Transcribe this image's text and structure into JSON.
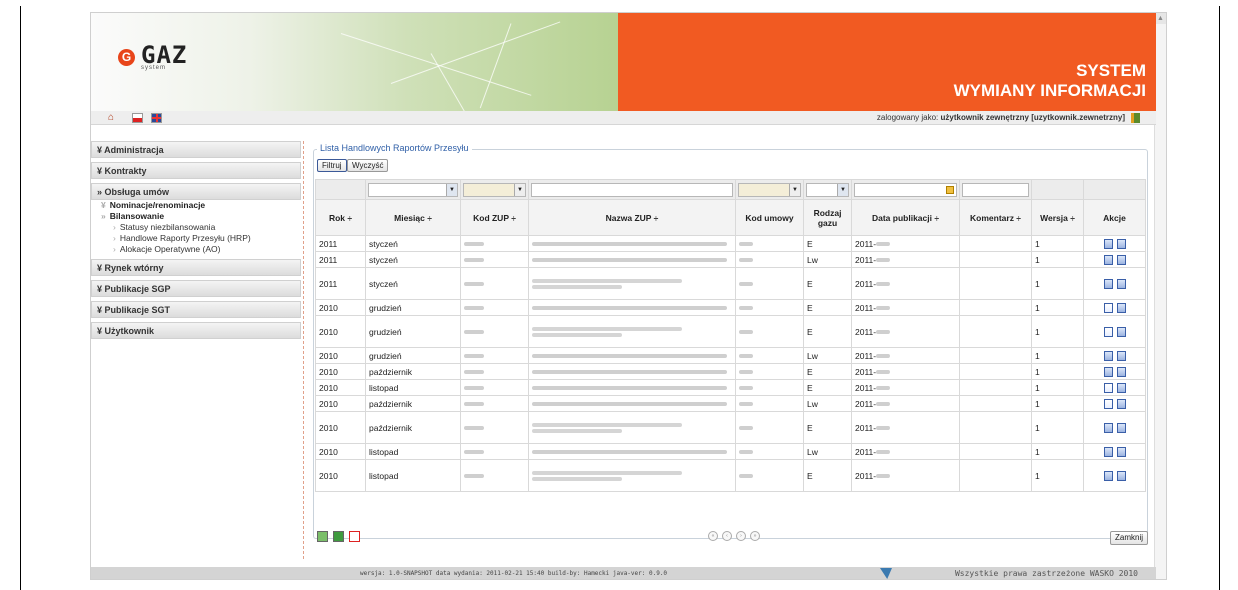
{
  "header": {
    "logo_text": "GAZ",
    "logo_sub": "system",
    "title_line1": "SYSTEM",
    "title_line2": "WYMIANY INFORMACJI"
  },
  "topbar": {
    "login_prefix": "zalogowany jako:",
    "login_user": "użytkownik zewnętrzny [uzytkownik.zewnetrzny]"
  },
  "sidebar": {
    "administracja": "Administracja",
    "kontrakty": "Kontrakty",
    "obsluga": "Obsługa umów",
    "nominacje": "Nominacje/renominacje",
    "bilansowanie": "Bilansowanie",
    "statusy": "Statusy niezbilansowania",
    "hrp": "Handlowe Raporty Przesyłu (HRP)",
    "ao": "Alokacje Operatywne (AO)",
    "rynek": "Rynek wtórny",
    "sgp": "Publikacje SGP",
    "sgt": "Publikacje SGT",
    "uzytkownik": "Użytkownik"
  },
  "panel": {
    "legend": "Lista Handlowych Raportów Przesyłu",
    "filter_btn": "Filtruj",
    "clear_btn": "Wyczyść",
    "close_btn": "Zamknij"
  },
  "table": {
    "headers": {
      "rok": "Rok ÷",
      "miesiac": "Miesiąc ÷",
      "kod_zup": "Kod ZUP ÷",
      "nazwa_zup": "Nazwa ZUP ÷",
      "kod_umowy": "Kod umowy",
      "rodzaj_gazu": "Rodzaj gazu",
      "data_pub": "Data publikacji ÷",
      "komentarz": "Komentarz ÷",
      "wersja": "Wersja ÷",
      "akcje": "Akcje"
    },
    "rows": [
      {
        "rok": "2011",
        "miesiac": "styczeń",
        "gaz": "E",
        "data": "2011-",
        "wersja": "1"
      },
      {
        "rok": "2011",
        "miesiac": "styczeń",
        "gaz": "Lw",
        "data": "2011-",
        "wersja": "1"
      },
      {
        "rok": "2011",
        "miesiac": "styczeń",
        "gaz": "E",
        "data": "2011-",
        "wersja": "1"
      },
      {
        "rok": "2010",
        "miesiac": "grudzień",
        "gaz": "E",
        "data": "2011-",
        "wersja": "1"
      },
      {
        "rok": "2010",
        "miesiac": "grudzień",
        "gaz": "E",
        "data": "2011-",
        "wersja": "1"
      },
      {
        "rok": "2010",
        "miesiac": "grudzień",
        "gaz": "Lw",
        "data": "2011-",
        "wersja": "1"
      },
      {
        "rok": "2010",
        "miesiac": "październik",
        "gaz": "E",
        "data": "2011-",
        "wersja": "1"
      },
      {
        "rok": "2010",
        "miesiac": "listopad",
        "gaz": "E",
        "data": "2011-",
        "wersja": "1"
      },
      {
        "rok": "2010",
        "miesiac": "październik",
        "gaz": "Lw",
        "data": "2011-",
        "wersja": "1"
      },
      {
        "rok": "2010",
        "miesiac": "październik",
        "gaz": "E",
        "data": "2011-",
        "wersja": "1"
      },
      {
        "rok": "2010",
        "miesiac": "listopad",
        "gaz": "Lw",
        "data": "2011-",
        "wersja": "1"
      },
      {
        "rok": "2010",
        "miesiac": "listopad",
        "gaz": "E",
        "data": "2011-",
        "wersja": "1"
      }
    ]
  },
  "footer": {
    "copyright": "Wszystkie prawa zastrzeżone WASKO 2010",
    "version": "wersja: 1.0-SNAPSHOT data wydania: 2011-02-21 15:40 build-by: Hamecki java-ver: 0.9.0"
  }
}
